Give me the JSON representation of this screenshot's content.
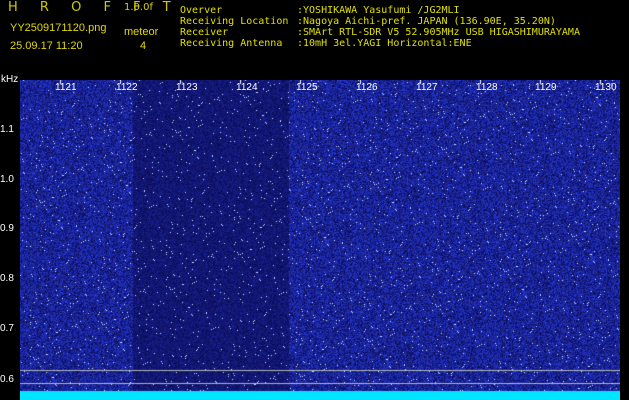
{
  "header": {
    "app_title": "H R O F F T",
    "version": "1.0.0f",
    "filename": "YY2509171120.png",
    "meteor_label": "meteor",
    "datetime": "25.09.17 11:20",
    "meteor_count": "4"
  },
  "info": [
    {
      "key": "Overver",
      "value": ":YOSHIKAWA Yasufumi /JG2MLI"
    },
    {
      "key": "Receiving Location",
      "value": ":Nagoya Aichi-pref. JAPAN (136.90E, 35.20N)"
    },
    {
      "key": "Receiver",
      "value": ":SMArt RTL-SDR V5 52.905MHz USB HIGASHIMURAYAMA"
    },
    {
      "key": "Receiving Antenna",
      "value": ":10mH 3el.YAGI Horizontal:ENE"
    }
  ],
  "axes": {
    "unit": "kHz",
    "y_ticks": [
      "1.1",
      "1.0",
      "0.9",
      "0.8",
      "0.7",
      "0.6"
    ],
    "x_ticks": [
      "1121",
      "1122",
      "1123",
      "1124",
      "1125",
      "1126",
      "1127",
      "1128",
      "1129",
      "1130"
    ]
  },
  "colors": {
    "background": "#000000",
    "spectrogram_noise": "#1a2fd0",
    "baseline": "#00e5ff",
    "text_yellow": "#e0d800"
  }
}
